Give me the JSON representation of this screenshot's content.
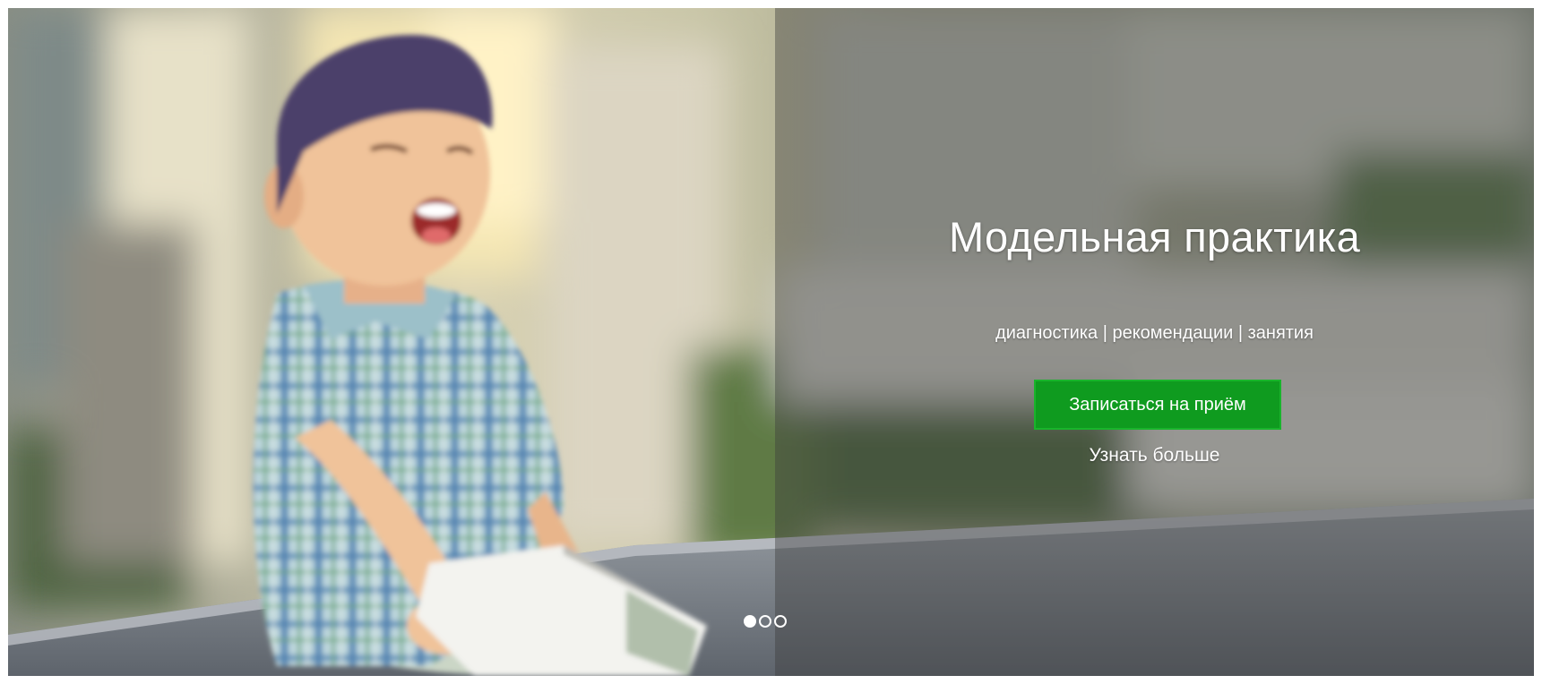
{
  "hero": {
    "title": "Модельная практика",
    "subtitle": "диагностика | рекомендации | занятия",
    "cta_label": "Записаться на приём",
    "more_label": "Узнать больше"
  },
  "carousel": {
    "slide_count": 3,
    "active_index": 0
  },
  "colors": {
    "cta_background": "#0f9b1f",
    "cta_border": "#19b42b",
    "overlay": "rgba(60,60,60,0.42)",
    "text": "#ffffff"
  },
  "icons": {
    "indicator_active": "filled-circle",
    "indicator_inactive": "hollow-circle"
  }
}
